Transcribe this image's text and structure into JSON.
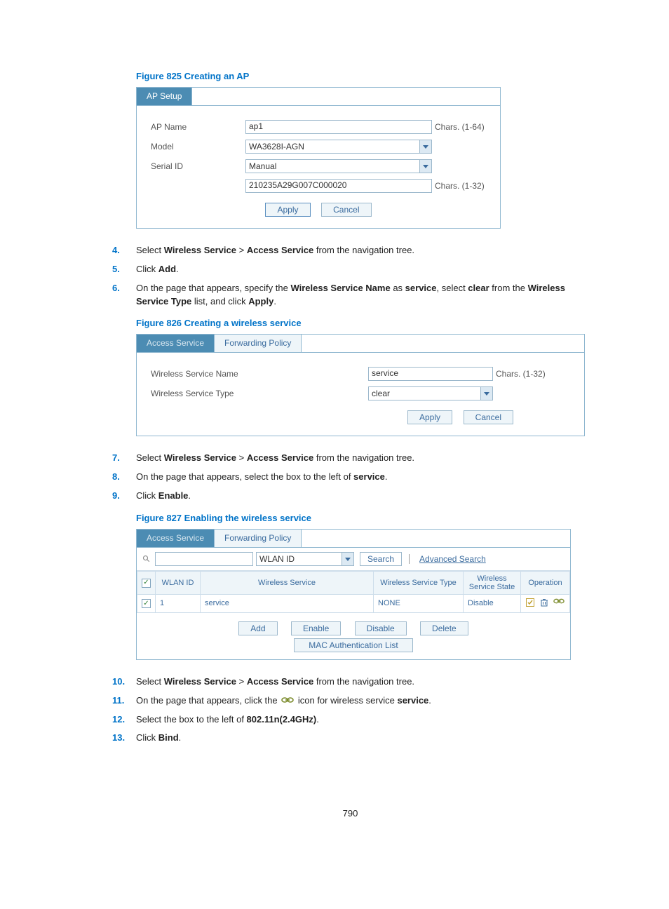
{
  "fig825": {
    "caption": "Figure 825 Creating an AP",
    "tab": "AP Setup",
    "rows": {
      "ap_name_label": "AP Name",
      "ap_name_value": "ap1",
      "ap_name_hint": "Chars. (1-64)",
      "model_label": "Model",
      "model_value": "WA3628I-AGN",
      "serial_label": "Serial ID",
      "serial_value": "Manual",
      "serial_input": "210235A29G007C000020",
      "serial_hint": "Chars. (1-32)"
    },
    "apply": "Apply",
    "cancel": "Cancel"
  },
  "steps_a": {
    "s4": {
      "n": "4.",
      "pre": "Select ",
      "b1": "Wireless Service",
      "mid": " > ",
      "b2": "Access Service",
      "post": " from the navigation tree."
    },
    "s5": {
      "n": "5.",
      "pre": "Click ",
      "b1": "Add",
      "post": "."
    },
    "s6": {
      "n": "6.",
      "pre": "On the page that appears, specify the ",
      "b1": "Wireless Service Name",
      "mid": " as ",
      "b2": "service",
      "mid2": ", select ",
      "b3": "clear",
      "mid3": " from the ",
      "b4": "Wireless Service Type",
      "mid4": " list, and click ",
      "b5": "Apply",
      "post": "."
    }
  },
  "fig826": {
    "caption": "Figure 826 Creating a wireless service",
    "tab_active": "Access Service",
    "tab_inactive": "Forwarding Policy",
    "name_label": "Wireless Service Name",
    "name_value": "service",
    "name_hint": "Chars. (1-32)",
    "type_label": "Wireless Service Type",
    "type_value": "clear",
    "apply": "Apply",
    "cancel": "Cancel"
  },
  "steps_b": {
    "s7": {
      "n": "7.",
      "pre": "Select ",
      "b1": "Wireless Service",
      "mid": " > ",
      "b2": "Access Service",
      "post": " from the navigation tree."
    },
    "s8": {
      "n": "8.",
      "pre": "On the page that appears, select the box to the left of ",
      "b1": "service",
      "post": "."
    },
    "s9": {
      "n": "9.",
      "pre": "Click ",
      "b1": "Enable",
      "post": "."
    }
  },
  "fig827": {
    "caption": "Figure 827 Enabling the wireless service",
    "tab_active": "Access Service",
    "tab_inactive": "Forwarding Policy",
    "search_field": "WLAN ID",
    "search_btn": "Search",
    "adv_search": "Advanced Search",
    "headers": {
      "h1": "WLAN ID",
      "h2": "Wireless Service",
      "h3": "Wireless Service Type",
      "h4": "Wireless Service State",
      "h5": "Operation"
    },
    "row": {
      "wlan_id": "1",
      "service": "service",
      "type": "NONE",
      "state": "Disable"
    },
    "btns": {
      "add": "Add",
      "enable": "Enable",
      "disable": "Disable",
      "delete": "Delete",
      "mac": "MAC Authentication List"
    }
  },
  "steps_c": {
    "s10": {
      "n": "10.",
      "pre": "Select ",
      "b1": "Wireless Service",
      "mid": " > ",
      "b2": "Access Service",
      "post": " from the navigation tree."
    },
    "s11": {
      "n": "11.",
      "pre": "On the page that appears, click the ",
      "post1": " icon for wireless service ",
      "b1": "service",
      "post": "."
    },
    "s12": {
      "n": "12.",
      "pre": "Select the box to the left of ",
      "b1": "802.11n(2.4GHz)",
      "post": "."
    },
    "s13": {
      "n": "13.",
      "pre": "Click ",
      "b1": "Bind",
      "post": "."
    }
  },
  "page_number": "790"
}
